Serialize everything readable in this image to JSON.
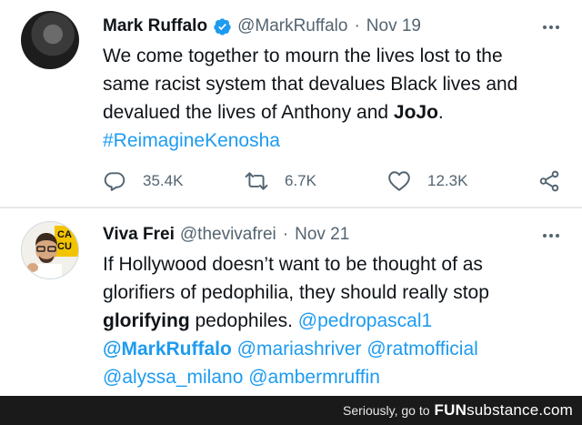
{
  "tweets": [
    {
      "author_name": "Mark Ruffalo",
      "verified": true,
      "handle": "@MarkRuffalo",
      "separator": "·",
      "date": "Nov 19",
      "text": {
        "line1": "We come together to mourn the lives lost to the",
        "line2": "same racist system that devalues Black lives and",
        "line3a": "devalued the lives of Anthony and ",
        "line3b": "JoJo",
        "line3c": ".",
        "hashtag": "#ReimagineKenosha"
      },
      "stats": {
        "replies": "35.4K",
        "retweets": "6.7K",
        "likes": "12.3K"
      }
    },
    {
      "author_name": "Viva Frei",
      "handle": "@thevivafrei",
      "separator": "·",
      "date": "Nov 21",
      "text": {
        "line1": "If Hollywood doesn’t want to be thought of as",
        "line2": "glorifiers of pedophilia, they should really stop",
        "line3a": "glorifying",
        "line3b": " pedophiles. ",
        "mention1": "@pedropascal1",
        "mention2": "@MarkRuffalo",
        "mention3": " @mariashriver",
        "mention4": " @ratmofficial",
        "mention5": "@alyssa_milano",
        "mention6": " @ambermruffin"
      }
    }
  ],
  "footer": {
    "text": "Seriously, go to",
    "brand_fun": "FUN",
    "brand_rest": "substance",
    "brand_tld": ".com"
  },
  "colors": {
    "link": "#1d9bf0",
    "muted": "#536471",
    "verified": "#1d9bf0"
  },
  "icons": [
    "verified-badge-icon",
    "more-options-icon",
    "reply-icon",
    "retweet-icon",
    "like-icon",
    "share-icon"
  ]
}
